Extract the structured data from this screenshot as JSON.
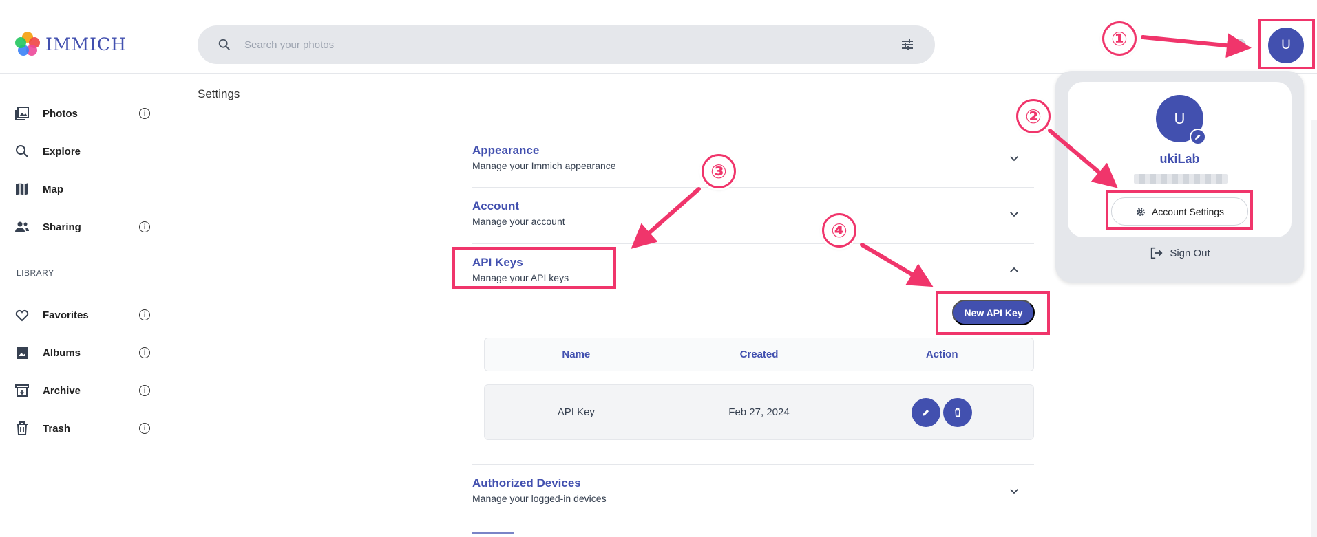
{
  "app": {
    "logo_text": "IMMICH"
  },
  "search": {
    "placeholder": "Search your photos"
  },
  "user": {
    "initial": "U",
    "name": "ukiLab"
  },
  "sidebar": {
    "items": [
      {
        "label": "Photos",
        "icon": "photos-icon"
      },
      {
        "label": "Explore",
        "icon": "search-icon"
      },
      {
        "label": "Map",
        "icon": "map-icon"
      },
      {
        "label": "Sharing",
        "icon": "sharing-icon"
      }
    ],
    "library_label": "LIBRARY",
    "library_items": [
      {
        "label": "Favorites",
        "icon": "heart-icon"
      },
      {
        "label": "Albums",
        "icon": "album-icon"
      },
      {
        "label": "Archive",
        "icon": "archive-icon"
      },
      {
        "label": "Trash",
        "icon": "trash-icon"
      }
    ]
  },
  "page": {
    "title": "Settings"
  },
  "settings": [
    {
      "title": "Appearance",
      "desc": "Manage your Immich appearance",
      "expanded": false
    },
    {
      "title": "Account",
      "desc": "Manage your account",
      "expanded": false
    },
    {
      "title": "API Keys",
      "desc": "Manage your API keys",
      "expanded": true
    },
    {
      "title": "Authorized Devices",
      "desc": "Manage your logged-in devices",
      "expanded": false
    }
  ],
  "api_keys": {
    "new_button": "New API Key",
    "columns": [
      "Name",
      "Created",
      "Action"
    ],
    "rows": [
      {
        "name": "API Key",
        "created": "Feb 27, 2024"
      }
    ]
  },
  "popup": {
    "account_settings": "Account Settings",
    "sign_out": "Sign Out"
  },
  "annotations": {
    "steps": [
      "①",
      "②",
      "③",
      "④"
    ],
    "color": "#f0356b"
  },
  "colors": {
    "accent": "#4250af",
    "highlight": "#f0356b"
  }
}
